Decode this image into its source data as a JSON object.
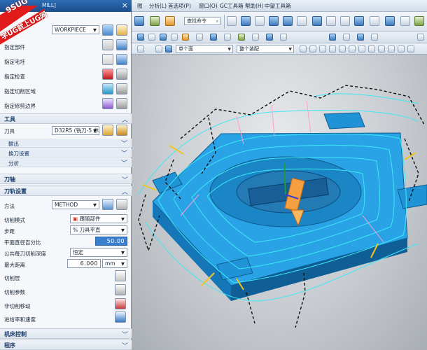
{
  "watermark": {
    "line1": "9SUG",
    "line2": "学UG就上UG网"
  },
  "dialog": {
    "title": "MILL]",
    "close_glyph": "×",
    "geometry": {
      "workpiece_value": "WORKPIECE",
      "rows": [
        "指定部件",
        "指定毛坯",
        "指定检查",
        "指定切削区域",
        "指定修剪边界"
      ]
    },
    "tool_section": {
      "title": "工具",
      "tool_label": "刀具",
      "tool_value": "D32R5 (铣刀-5 参",
      "subsections": [
        "輸出",
        "换刀设置",
        "分析"
      ]
    },
    "axis_section": {
      "title": "刀轴"
    },
    "cut_settings": {
      "title": "刀轨设置",
      "method_label": "方法",
      "method_value": "METHOD",
      "cut_mode_label": "切削模式",
      "cut_mode_value": "跟随部件",
      "stepover_label": "步距",
      "stepover_value": "% 刀具平直",
      "flat_percent_label": "平面直径百分比",
      "flat_percent_value": "50.00",
      "common_depth_label": "公共每刀切削深度",
      "common_depth_value": "恒定",
      "max_distance_label": "最大距离",
      "max_distance_value": "6.000",
      "max_distance_unit": "mm",
      "cut_levels_label": "切削层",
      "cut_params_label": "切削参数",
      "non_cutting_label": "非切削移动",
      "feeds_speeds_label": "进给率和速度"
    },
    "machine_control": {
      "title": "机床控制"
    },
    "program": {
      "title": "程序"
    }
  },
  "menubar": {
    "items": [
      "图",
      "分析(L)",
      "首选项(P)",
      "窗口(O)",
      "GC工具箱",
      "帮助(H)",
      "中望工具箱"
    ]
  },
  "toolbar": {
    "command_search_value": "查找命令",
    "filter_left_value": "单个面",
    "filter_right_value": "整个装配"
  },
  "colors": {
    "part_blue": "#2aa3e6",
    "toolpath_cyan": "#3ee8f5",
    "rapid_black": "#111111",
    "dialog_title": "#1f5a9e"
  }
}
